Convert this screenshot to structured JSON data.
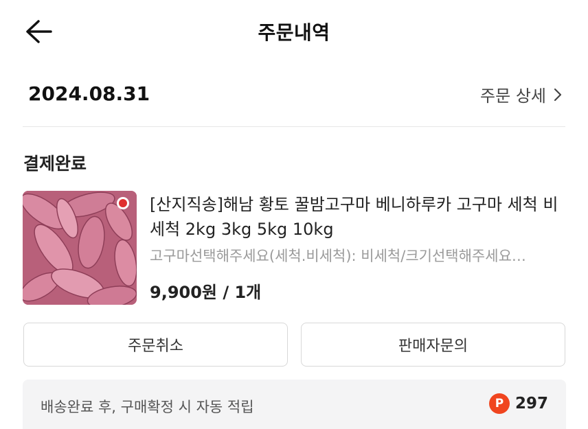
{
  "header": {
    "title": "주문내역",
    "back_icon": "arrow-left-icon"
  },
  "order": {
    "date": "2024.08.31",
    "detail_label": "주문 상세",
    "status": "결제완료"
  },
  "product": {
    "name": "[산지직송]해남 황토 꿀밤고구마 베니하루카 고구마 세척 비세척 2kg 3kg 5kg 10kg",
    "option": "고구마선택해주세요(세척.비세척): 비세척/크기선택해주세요…",
    "price": "9,900원 / 1개",
    "image_desc": "sweet-potato-image"
  },
  "actions": {
    "cancel_label": "주문취소",
    "inquiry_label": "판매자문의"
  },
  "points": {
    "text": "배송완료 후, 구매확정 시 자동 적립",
    "badge": "P",
    "value": "297"
  },
  "colors": {
    "points_badge": "#f0451f",
    "muted_text": "#9a9a9a",
    "points_bg": "#f4f4f5"
  }
}
